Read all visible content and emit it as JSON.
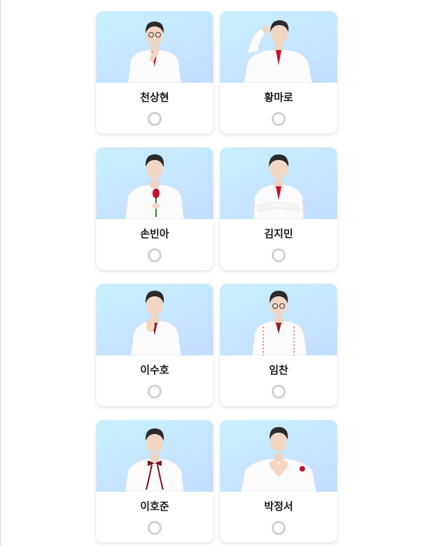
{
  "candidates": [
    {
      "name": "천상현",
      "selected": false
    },
    {
      "name": "황마로",
      "selected": false
    },
    {
      "name": "손빈아",
      "selected": false
    },
    {
      "name": "김지민",
      "selected": false
    },
    {
      "name": "이수호",
      "selected": false
    },
    {
      "name": "임찬",
      "selected": false
    },
    {
      "name": "이호준",
      "selected": false
    },
    {
      "name": "박정서",
      "selected": false
    }
  ],
  "colors": {
    "photo_gradient_start": "#c8f0ff",
    "photo_gradient_end": "#c4dcff",
    "radio_border": "#d0d0d0",
    "suit": "#ffffff",
    "accent_red": "#c8102e"
  }
}
